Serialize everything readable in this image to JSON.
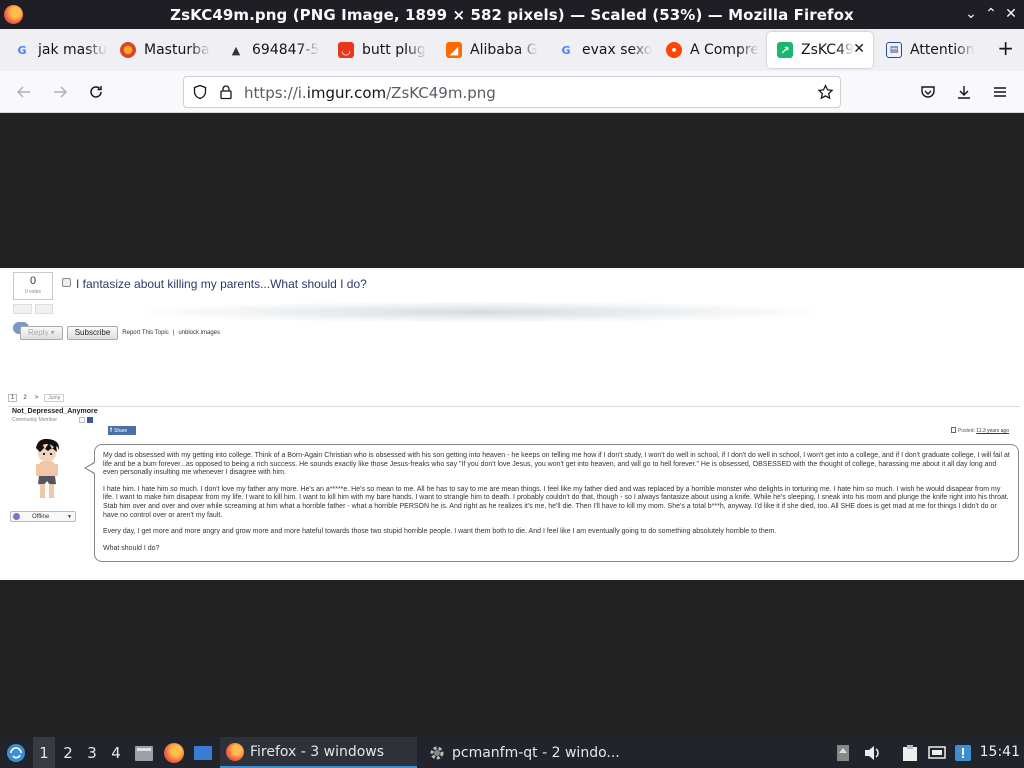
{
  "window": {
    "title": "ZsKC49m.png (PNG Image, 1899 × 582 pixels) — Scaled (53%) — Mozilla Firefox",
    "minimize_symbol": "⌄",
    "maximize_symbol": "⌃",
    "close_symbol": "✕"
  },
  "tabs": [
    {
      "label": "jak mastu",
      "icon": "google-icon",
      "icon_color": "#4285f4"
    },
    {
      "label": "Masturba",
      "icon": "site-icon",
      "icon_color": "#d9442b"
    },
    {
      "label": "694847-5",
      "icon": "pyramid-icon",
      "icon_color": "#333333"
    },
    {
      "label": "butt plug",
      "icon": "shop-icon",
      "icon_color": "#e8371a"
    },
    {
      "label": "Alibaba G",
      "icon": "alibaba-icon",
      "icon_color": "#ff6a00"
    },
    {
      "label": "evax sexo",
      "icon": "google-icon",
      "icon_color": "#4285f4"
    },
    {
      "label": "A Compre",
      "icon": "reddit-icon",
      "icon_color": "#ff4500"
    },
    {
      "label": "ZsKC49",
      "icon": "imgur-icon",
      "icon_color": "#1bb76e",
      "active": true
    },
    {
      "label": "Attention",
      "icon": "doc-icon",
      "icon_color": "#2a4a9a"
    }
  ],
  "navbar": {
    "url_prefix": "https://i.",
    "url_domain": "imgur.com",
    "url_path": "/ZsKC49m.png"
  },
  "forum": {
    "votes": "0",
    "votes_label": "0 votes",
    "topic_title": "I fantasize about killing my parents...What should I do?",
    "reply_label": "Reply",
    "subscribe_label": "Subscribe",
    "report_link": "Report This Topic",
    "separator": "|",
    "unblock_link": "unblock images",
    "pages": [
      "1",
      "2",
      ">"
    ],
    "jump_label": "Jump",
    "username": "Not_Depressed_Anymore",
    "user_title": "Community Member",
    "status": "Offline",
    "share_label": "Share",
    "posted_prefix": "Posted:",
    "posted_time": "11.3 years ago",
    "post_paragraphs": [
      "My dad is obsessed with my getting into college. Think of a Born-Again Christian who is obsessed with his son getting into heaven - he keeps on telling me how if I don't study, I won't do well in school, if I don't do well in school, I won't get into a college, and if I don't graduate college, I will fail at life and be a bum forever...as opposed to being a rich success. He sounds exactly like those Jesus-freaks who say \"If you don't love Jesus, you won't get into heaven, and will go to hell forever.\" He is obsessed, OBSESSED with the thought of college, harassing me about it all day long and even personally insulting me whenever I disagree with him.",
      "I hate him. I hate him so much. I don't love my father any more. He's an a*****e. He's so mean to me. All he has to say to me are mean things. I feel like my father died and was replaced by a horrible monster who delights in torturing me. I hate him so much. I wish he would disapear from my life. I want to make him disapear from my life. I want to kill him. I want to kill him with my bare hands. I want to strangle him to death. I probably couldn't do that, though - so I always fantasize about using a knife. While he's sleeping, I sneak into his room and plunge the knife right into his throat. Stab him over and over and over while screaming at him what a horrible father - what a horrible PERSON he is. And right as he realizes it's me, he'll die. Then I'll have to kill my mom. She's a total b***h, anyway. I'd like it if she died, too. All SHE does is get mad at me for things I didn't do or have no control over or aren't my fault.",
      "Every day, I get more and more angry and grow more and more hateful towards those two stupid horrible people. I want them both to die. And I feel like I am eventually going to do something absolutely horrible to them.",
      "What should I do?"
    ]
  },
  "taskbar": {
    "workspaces": [
      "1",
      "2",
      "3",
      "4"
    ],
    "firefox_task": "Firefox - 3 windows",
    "pcmanfm_task": "pcmanfm-qt - 2 windo...",
    "clock": "15:41"
  },
  "colors": {
    "titlebar_bg": "#1f1e25",
    "tabbar_bg": "#f0f0f4",
    "viewport_bg": "#222222",
    "taskbar_bg": "#21252b",
    "accent": "#3d8fd1"
  }
}
